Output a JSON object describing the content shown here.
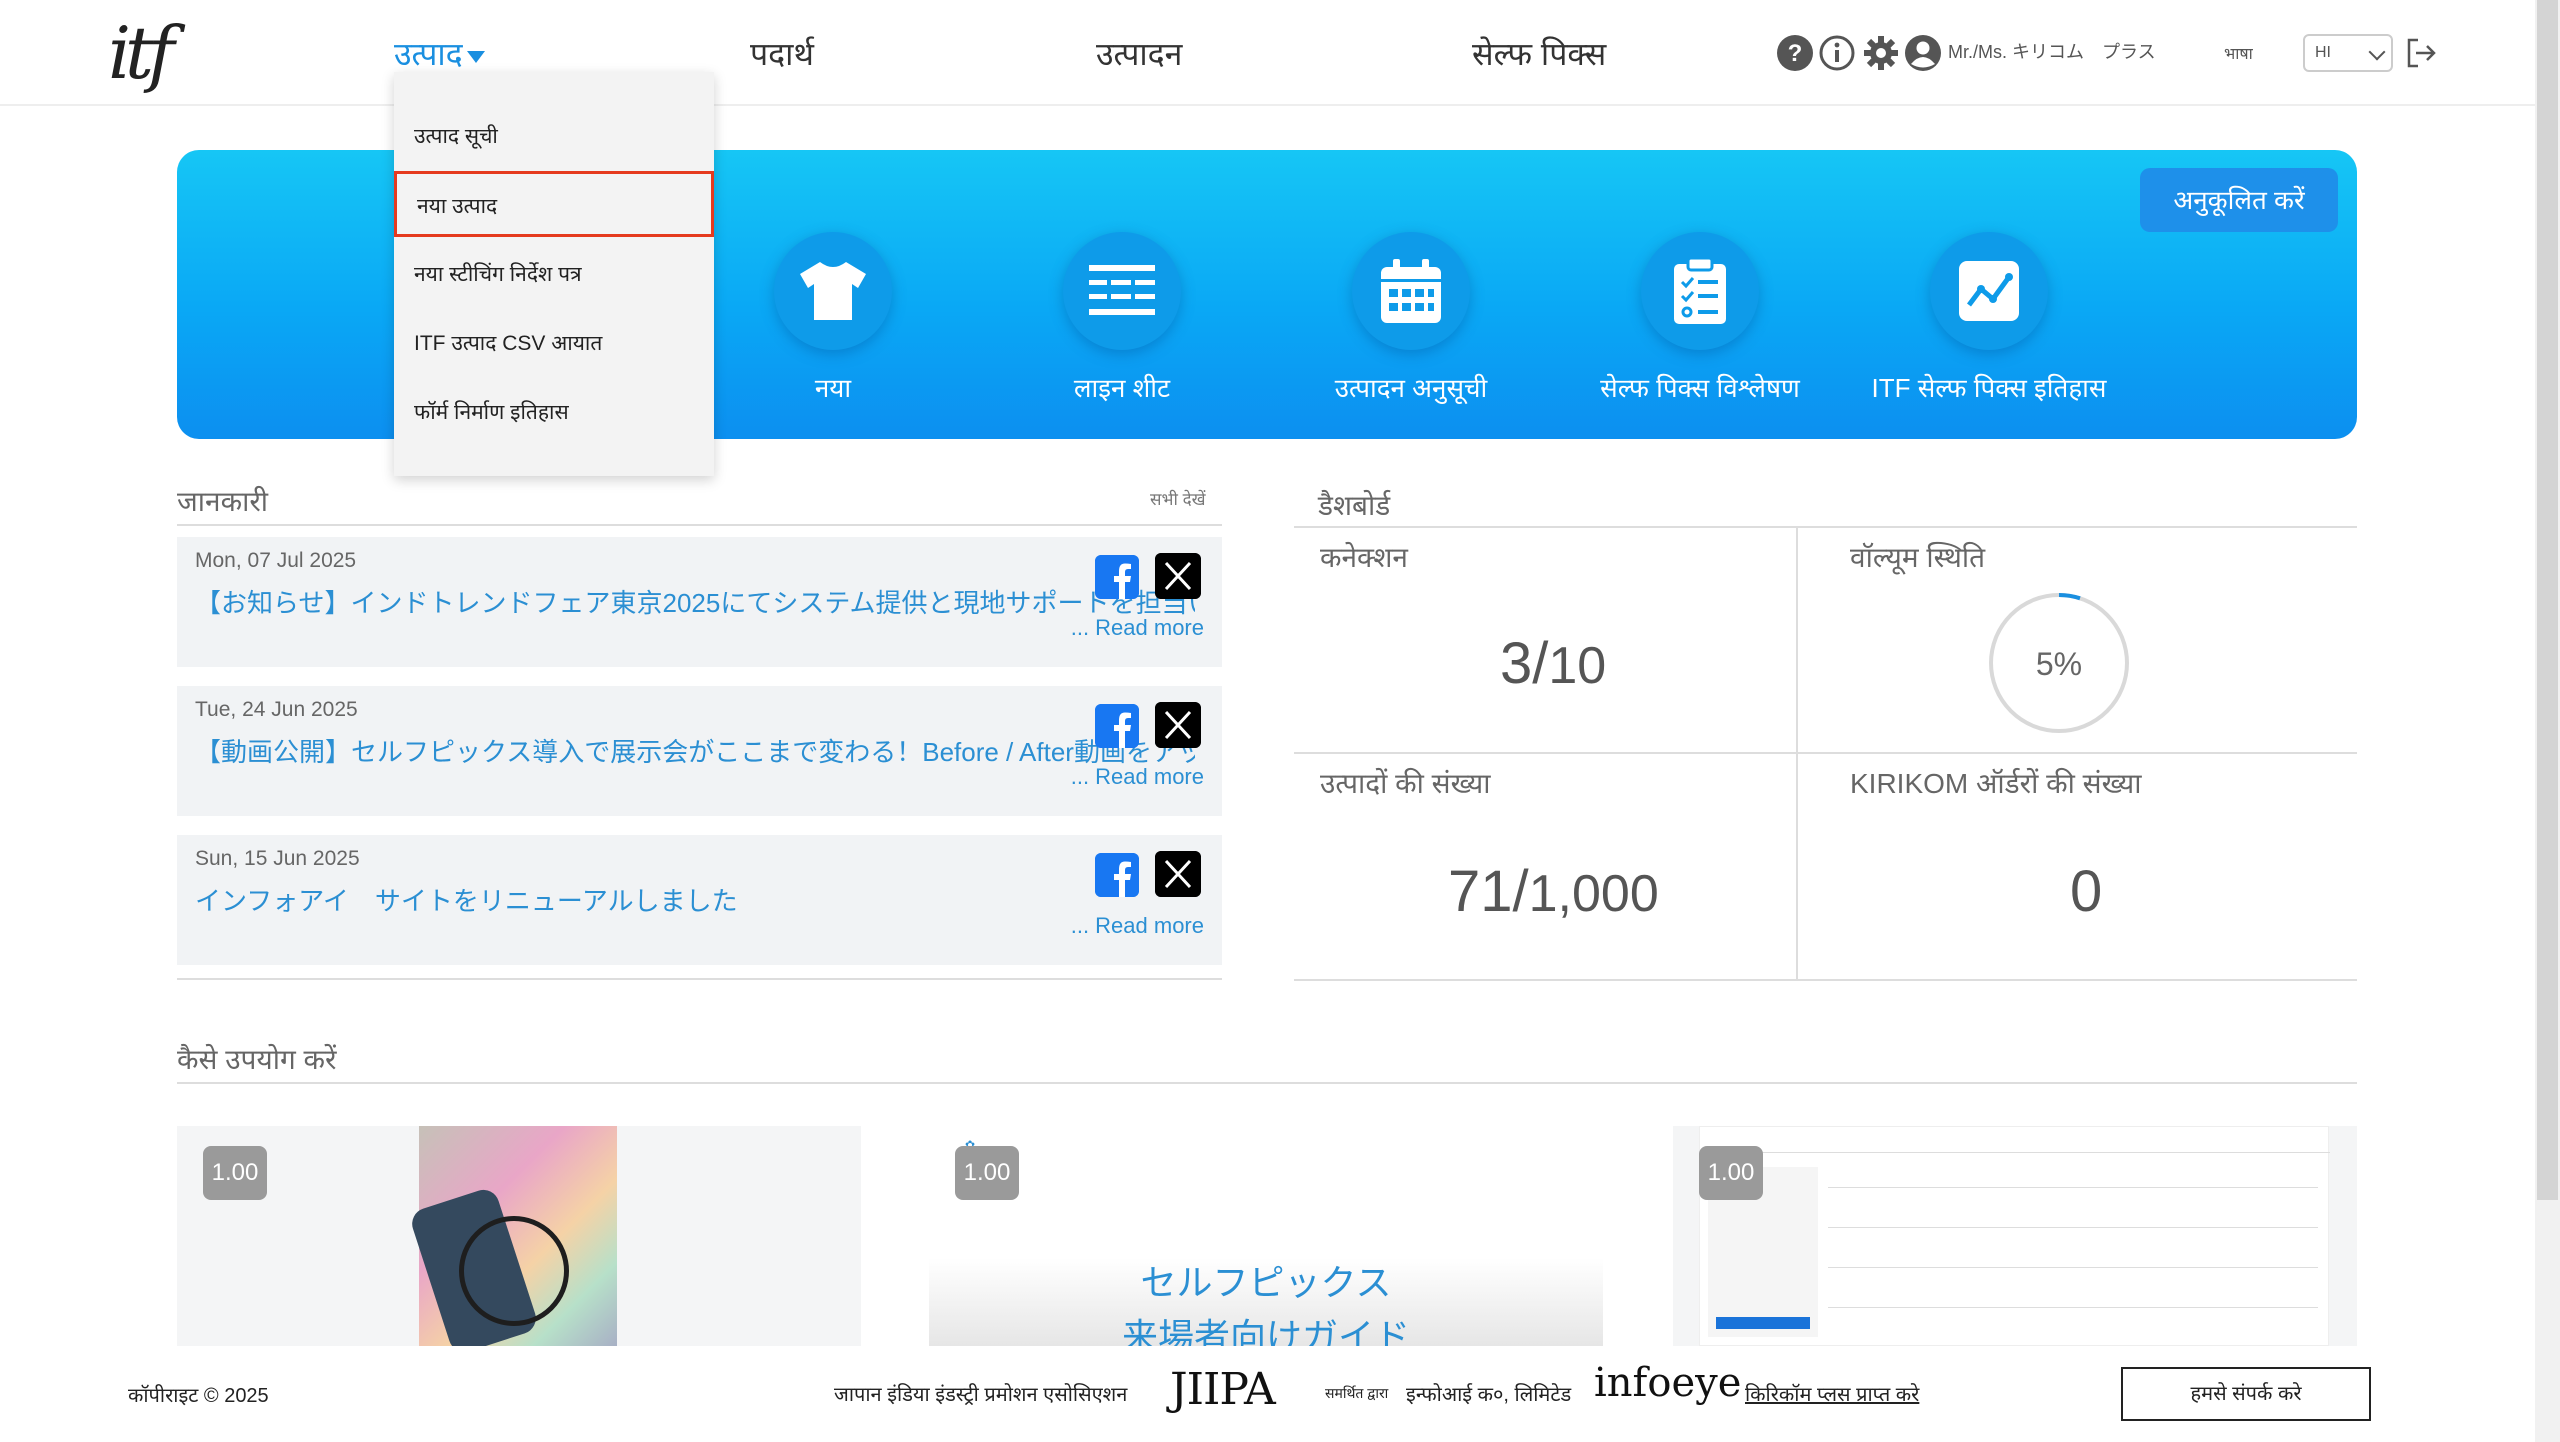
{
  "header": {
    "logo_text": "itf",
    "nav": [
      {
        "label": "उत्पाद"
      },
      {
        "label": "पदार्थ"
      },
      {
        "label": "उत्पादन"
      },
      {
        "label": "सेल्फ पिक्स"
      }
    ],
    "user_name": "Mr./Ms. キリコム　プラス",
    "language_label": "भाषा",
    "language_value": "HI"
  },
  "dropdown": {
    "items": [
      {
        "label": "उत्पाद सूची"
      },
      {
        "label": "नया उत्पाद"
      },
      {
        "label": "नया स्टीचिंग निर्देश पत्र"
      },
      {
        "label": "ITF उत्पाद CSV आयात"
      },
      {
        "label": "फॉर्म निर्माण इतिहास"
      }
    ]
  },
  "banner": {
    "customize_label": "अनुकूलित करें",
    "shortcuts": [
      {
        "label": "नया",
        "icon": "tshirt-icon"
      },
      {
        "label": "लाइन शीट",
        "icon": "line-sheet-icon"
      },
      {
        "label": "उत्पादन अनुसूची",
        "icon": "calendar-icon"
      },
      {
        "label": "सेल्फ पिक्स विश्लेषण",
        "icon": "checklist-icon"
      },
      {
        "label": "ITF सेल्फ पिक्स इतिहास",
        "icon": "chart-icon"
      }
    ]
  },
  "info": {
    "title": "जानकारी",
    "see_all": "सभी देखें",
    "read_more": "... Read more",
    "news": [
      {
        "date": "Mon, 07 Jul 2025",
        "title": "【お知らせ】インドトレンドフェア東京2025にてシステム提供と現地サポートを担当いた"
      },
      {
        "date": "Tue, 24 Jun 2025",
        "title": "【動画公開】セルフピックス導入で展示会がここまで変わる！Before / After動画をアッ"
      },
      {
        "date": "Sun, 15 Jun 2025",
        "title": "インフォアイ　サイトをリニューアルしました"
      }
    ]
  },
  "dashboard": {
    "title": "डैशबोर्ड",
    "connection_label": "कनेक्शन",
    "connection_value": "3",
    "connection_total": "10",
    "volume_label": "वॉल्यूम स्थिति",
    "volume_percent": 5,
    "volume_text": "5%",
    "products_label": "उत्पादों की संख्या",
    "products_value": "71",
    "products_total": "1,000",
    "orders_label": "KIRIKOM ऑर्डरों की संख्या",
    "orders_value": "0"
  },
  "howto": {
    "title": "कैसे उपयोग करें",
    "videos": [
      {
        "speed": "1.00"
      },
      {
        "speed": "1.00",
        "caption_line1": "セルフピックス",
        "caption_line2": "来場者向けガイド"
      },
      {
        "speed": "1.00"
      }
    ]
  },
  "footer": {
    "copyright": "कॉपीराइट © 2025",
    "association": "जापान इंडिया इंडस्ट्री प्रमोशन एसोसिएशन",
    "jiipa_logo": "JIIPA",
    "supported_by": "समर्थित द्वारा",
    "company": "इन्फोआई क०, लिमिटेड",
    "infoeye_logo": "infoeye",
    "kirikom_link": "किरिकॉम प्लस प्राप्त करे",
    "contact": "हमसे संपर्क करे"
  }
}
